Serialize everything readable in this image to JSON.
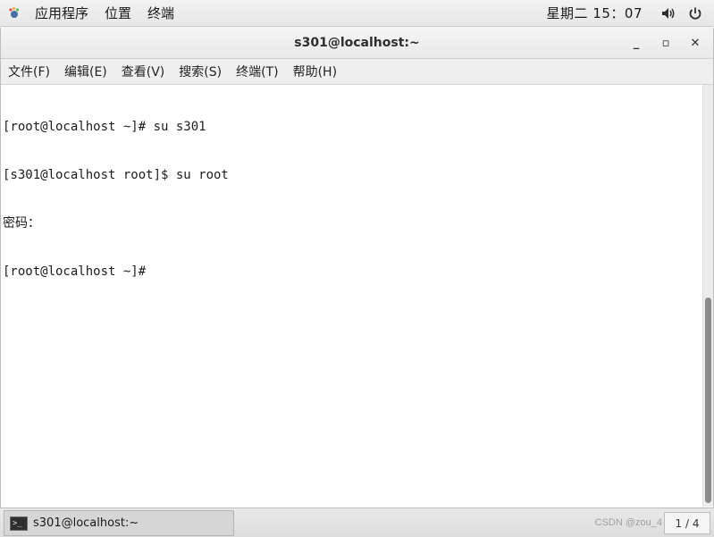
{
  "topbar": {
    "applications": "应用程序",
    "places": "位置",
    "terminal": "终端",
    "clock": "星期二 15：07",
    "icons": {
      "apps": "gnome-foot-icon",
      "volume": "volume-icon",
      "power": "power-icon"
    }
  },
  "window": {
    "title": "s301@localhost:~",
    "controls": {
      "minimize": "_",
      "maximize": "▫",
      "close": "✕"
    }
  },
  "menubar": {
    "items": [
      {
        "label": "文件(F)"
      },
      {
        "label": "编辑(E)"
      },
      {
        "label": "查看(V)"
      },
      {
        "label": "搜索(S)"
      },
      {
        "label": "终端(T)"
      },
      {
        "label": "帮助(H)"
      }
    ]
  },
  "terminal": {
    "lines": [
      "[root@localhost ~]# su s301",
      "[s301@localhost root]$ su root",
      "密码：",
      "[root@localhost ~]#"
    ]
  },
  "taskbar": {
    "window_label": "s301@localhost:~",
    "watermark": "CSDN @zou_4",
    "pager": "1 / 4"
  },
  "colors": {
    "terminal_bg": "#ffffff",
    "terminal_fg": "#1c1c1c",
    "scroll_thumb": "#8b8b8b"
  }
}
